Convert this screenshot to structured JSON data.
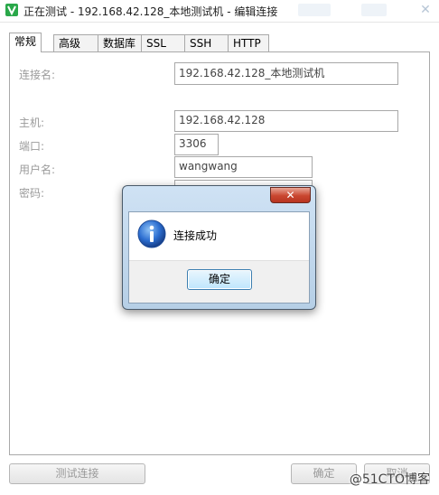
{
  "window": {
    "title": "正在测试 - 192.168.42.128_本地测试机 - 编辑连接",
    "close_glyph": "✕"
  },
  "tabs": [
    "常规",
    "高级",
    "数据库",
    "SSL",
    "SSH",
    "HTTP"
  ],
  "form": {
    "conn_name_label": "连接名:",
    "conn_name_value": "192.168.42.128_本地测试机",
    "host_label": "主机:",
    "host_value": "192.168.42.128",
    "port_label": "端口:",
    "port_value": "3306",
    "user_label": "用户名:",
    "user_value": "wangwang",
    "password_label": "密码:"
  },
  "footer": {
    "test_button": "测试连接",
    "ok_button": "确定",
    "cancel_button": "取消"
  },
  "dialog": {
    "message": "连接成功",
    "ok_button": "确定",
    "close_glyph": "✕"
  },
  "watermark": "@51CTO博客",
  "colors": {
    "accent": "#3c7fb1",
    "close_red": "#c9462f"
  }
}
